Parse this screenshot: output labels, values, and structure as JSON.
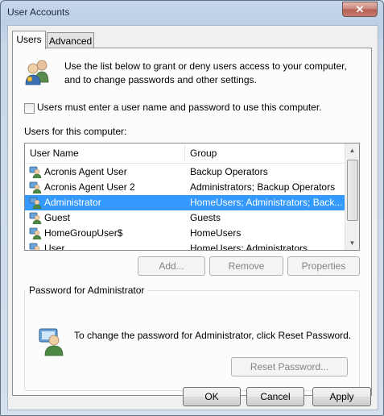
{
  "window": {
    "title": "User Accounts",
    "close_glyph": "✕"
  },
  "tabs": [
    {
      "label": "Users"
    },
    {
      "label": "Advanced"
    }
  ],
  "intro_text": "Use the list below to grant or deny users access to your computer, and to change passwords and other settings.",
  "require_password": {
    "label": "Users must enter a user name and password to use this computer.",
    "checked": false
  },
  "users_list": {
    "label": "Users for this computer:",
    "columns": [
      "User Name",
      "Group"
    ],
    "rows": [
      {
        "name": "Acronis Agent User",
        "group": "Backup Operators",
        "selected": false
      },
      {
        "name": "Acronis Agent User 2",
        "group": "Administrators; Backup Operators",
        "selected": false
      },
      {
        "name": "Administrator",
        "group": "HomeUsers; Administrators; Back...",
        "selected": true
      },
      {
        "name": "Guest",
        "group": "Guests",
        "selected": false
      },
      {
        "name": "HomeGroupUser$",
        "group": "HomeUsers",
        "selected": false
      },
      {
        "name": "User",
        "group": "HomeUsers; Administrators",
        "selected": false
      }
    ]
  },
  "list_buttons": {
    "add": "Add...",
    "remove": "Remove",
    "properties": "Properties"
  },
  "password_group": {
    "title": "Password for Administrator",
    "text": "To change the password for Administrator, click Reset Password.",
    "reset_button": "Reset Password..."
  },
  "footer": {
    "ok": "OK",
    "cancel": "Cancel",
    "apply": "Apply"
  },
  "colors": {
    "selection": "#3399ff",
    "panel": "#fcfcfc",
    "dialog": "#f0f0f0"
  },
  "icons": {
    "users": "users-icon",
    "user": "user-icon",
    "admin": "admin-user-icon"
  }
}
